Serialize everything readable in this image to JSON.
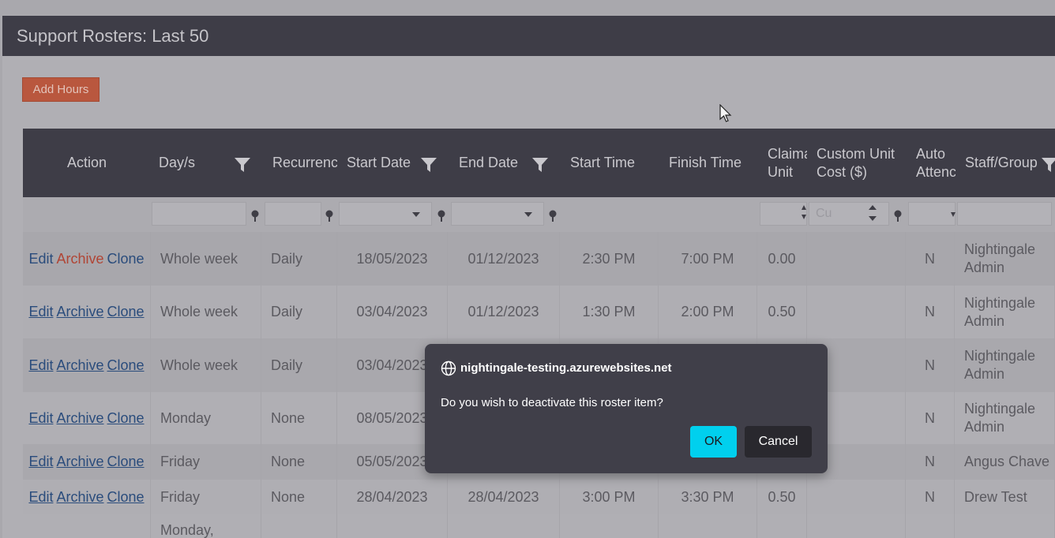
{
  "panel": {
    "title": "Support Rosters: Last 50"
  },
  "toolbar": {
    "add_hours_label": "Add Hours"
  },
  "columns": {
    "action": "Action",
    "days": "Day/s",
    "recurrence": "Recurrence",
    "start_date": "Start Date",
    "end_date": "End Date",
    "start_time": "Start Time",
    "finish_time": "Finish Time",
    "claimable_unit": "Claima Unit",
    "custom_unit_cost": "Custom Unit Cost ($)",
    "auto_attend": "Auto Attenc",
    "staff_group": "Staff/Group"
  },
  "filters": {
    "custom_cost_placeholder": "Cu"
  },
  "action_links": {
    "edit": "Edit",
    "archive": "Archive",
    "clone": "Clone"
  },
  "rows": [
    {
      "days": "Whole week",
      "recurrence": "Daily",
      "start_date": "18/05/2023",
      "end_date": "01/12/2023",
      "start_time": "2:30 PM",
      "finish_time": "7:00 PM",
      "unit": "0.00",
      "cost": "",
      "auto": "N",
      "staff": "Nightingale Admin"
    },
    {
      "days": "Whole week",
      "recurrence": "Daily",
      "start_date": "03/04/2023",
      "end_date": "01/12/2023",
      "start_time": "1:30 PM",
      "finish_time": "2:00 PM",
      "unit": "0.50",
      "cost": "",
      "auto": "N",
      "staff": "Nightingale Admin"
    },
    {
      "days": "Whole week",
      "recurrence": "Daily",
      "start_date": "03/04/2023",
      "end_date": "",
      "start_time": "",
      "finish_time": "",
      "unit": "",
      "cost": "",
      "auto": "N",
      "staff": "Nightingale Admin"
    },
    {
      "days": "Monday",
      "recurrence": "None",
      "start_date": "08/05/2023",
      "end_date": "",
      "start_time": "",
      "finish_time": "",
      "unit": "",
      "cost": "",
      "auto": "N",
      "staff": "Nightingale Admin"
    },
    {
      "days": "Friday",
      "recurrence": "None",
      "start_date": "05/05/2023",
      "end_date": "",
      "start_time": "",
      "finish_time": "",
      "unit": "",
      "cost": "",
      "auto": "N",
      "staff": "Angus Chave"
    },
    {
      "days": "Friday",
      "recurrence": "None",
      "start_date": "28/04/2023",
      "end_date": "28/04/2023",
      "start_time": "3:00 PM",
      "finish_time": "3:30 PM",
      "unit": "0.50",
      "cost": "",
      "auto": "N",
      "staff": "Drew Test"
    },
    {
      "days": "Monday,",
      "recurrence": "",
      "start_date": "",
      "end_date": "",
      "start_time": "",
      "finish_time": "",
      "unit": "",
      "cost": "",
      "auto": "",
      "staff": ""
    }
  ],
  "dialog": {
    "origin": "nightingale-testing.azurewebsites.net",
    "message": "Do you wish to deactivate this roster item?",
    "ok_label": "OK",
    "cancel_label": "Cancel"
  }
}
